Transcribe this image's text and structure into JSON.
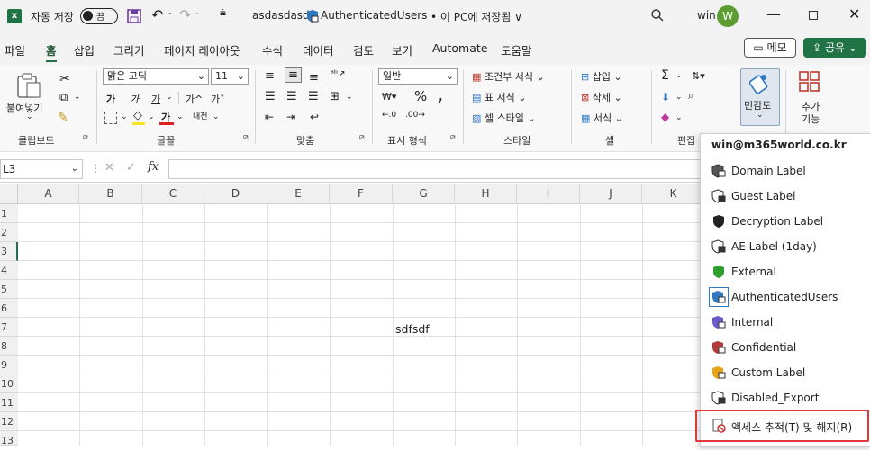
{
  "titlebar": {
    "autosave_label": "자동 저장",
    "autosave_state": "끔",
    "filename": "asdasdasd",
    "label_name": "AuthenticatedUsers",
    "save_status": "• 이 PC에 저장됨 ∨",
    "user_name": "win",
    "avatar_initial": "W",
    "accent": "#217346"
  },
  "menu": {
    "items": [
      "파일",
      "홈",
      "삽입",
      "그리기",
      "페이지 레이아웃",
      "수식",
      "데이터",
      "검토",
      "보기",
      "Automate",
      "도움말"
    ],
    "active": "홈",
    "memo": "메모",
    "share": "공유"
  },
  "ribbon": {
    "clipboard": {
      "paste": "붙여넣기",
      "label": "클립보드"
    },
    "font": {
      "name": "맑은 고딕",
      "size": "11",
      "label": "글꼴",
      "bold": "가",
      "italic": "가",
      "underline": "가",
      "grow": "가",
      "shrink": "가",
      "phonetic": "내천"
    },
    "alignment": {
      "label": "맞춤"
    },
    "number": {
      "format": "일반",
      "label": "표시 형식"
    },
    "styles": {
      "conditional": "조건부 서식",
      "table": "표 서식",
      "cell": "셀 스타일",
      "label": "스타일"
    },
    "cells": {
      "insert": "삽입",
      "delete": "삭제",
      "format": "서식",
      "label": "셀"
    },
    "editing": {
      "label": "편집"
    },
    "sensitivity": {
      "label": "민감도"
    },
    "addins": {
      "label1": "추가",
      "label2": "기능"
    }
  },
  "formula_bar": {
    "cell_ref": "L3",
    "fx": "fx"
  },
  "grid": {
    "columns": [
      "A",
      "B",
      "C",
      "D",
      "E",
      "F",
      "G",
      "H",
      "I",
      "J",
      "K"
    ],
    "rows": [
      "1",
      "2",
      "3",
      "4",
      "5",
      "6",
      "7",
      "8",
      "9",
      "10",
      "11",
      "12",
      "13"
    ],
    "cell_g7": "sdfsdf"
  },
  "sensitivity_menu": {
    "account": "win@m365world.co.kr",
    "items": [
      {
        "label": "Domain Label",
        "color": "#555555"
      },
      {
        "label": "Guest Label",
        "color": "#ffffff"
      },
      {
        "label": "Decryption Label",
        "color": "#222222"
      },
      {
        "label": "AE Label (1day)",
        "color": "#ffffff"
      },
      {
        "label": "External",
        "color": "#2e9e2e"
      },
      {
        "label": "AuthenticatedUsers",
        "color": "#2e78c2"
      },
      {
        "label": "Internal",
        "color": "#6a5acd"
      },
      {
        "label": "Confidential",
        "color": "#b33a3a"
      },
      {
        "label": "Custom Label",
        "color": "#e6a117"
      },
      {
        "label": "Disabled_Export",
        "color": "#ffffff"
      }
    ],
    "track_revoke": "액세스 추적(T) 및 해지(R)"
  }
}
